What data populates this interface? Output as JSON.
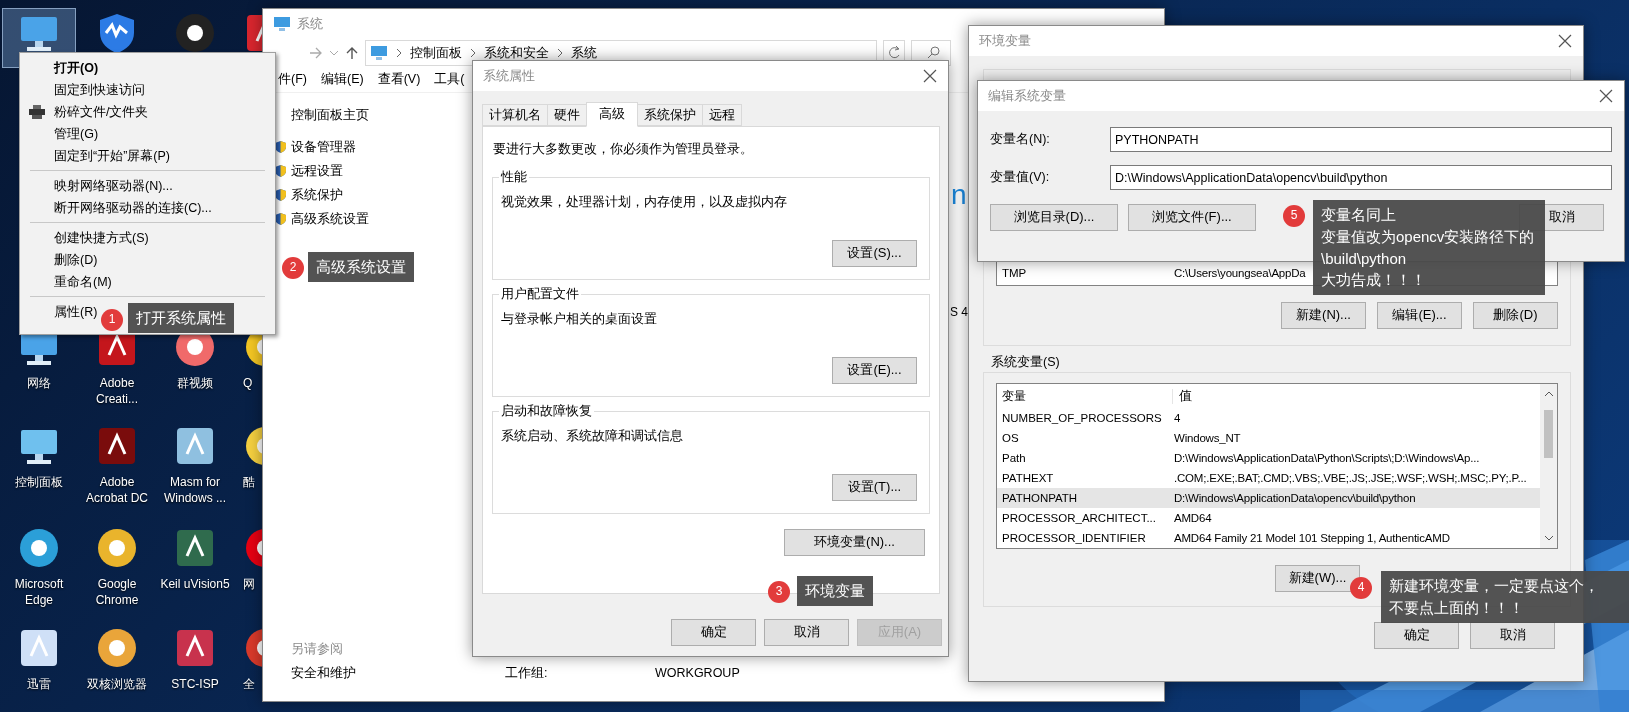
{
  "desktop": {
    "icon_rows": [
      [
        {
          "kind": "computer",
          "selected": true
        },
        {
          "kind": "guard",
          "selected": false
        },
        {
          "kind": "chat",
          "selected": false
        },
        {
          "kind": "red-app",
          "selected": false
        }
      ],
      [
        {
          "kind": "network",
          "label": "网络",
          "selected": false
        },
        {
          "kind": "creative",
          "label": "Adobe Creati...",
          "selected": false
        },
        {
          "kind": "video",
          "label": "群视频",
          "selected": false
        },
        {
          "kind": "qq",
          "label": "Q",
          "selected": false
        }
      ],
      [
        {
          "kind": "panel",
          "label": "控制面板",
          "selected": false
        },
        {
          "kind": "acrobat",
          "label": "Adobe Acrobat DC",
          "selected": false
        },
        {
          "kind": "asm",
          "label": "Masm for Windows ...",
          "selected": false
        },
        {
          "kind": "music",
          "label": "酷",
          "selected": false
        }
      ],
      [
        {
          "kind": "edge",
          "label": "Microsoft Edge",
          "selected": false
        },
        {
          "kind": "chrome",
          "label": "Google Chrome",
          "selected": false
        },
        {
          "kind": "keil",
          "label": "Keil uVision5",
          "selected": false
        },
        {
          "kind": "netease",
          "label": "网",
          "selected": false
        }
      ],
      [
        {
          "kind": "xunlei",
          "label": "迅雷",
          "selected": false
        },
        {
          "kind": "browser",
          "label": "双核浏览器",
          "selected": false
        },
        {
          "kind": "stc",
          "label": "STC-ISP",
          "selected": false
        },
        {
          "kind": "red",
          "label": "全",
          "selected": false
        }
      ]
    ]
  },
  "context_menu": {
    "items": [
      {
        "kind": "item",
        "label": "打开(O)",
        "default": true
      },
      {
        "kind": "item",
        "label": "固定到快速访问",
        "default": false
      },
      {
        "kind": "item-with-icon",
        "label": "粉碎文件/文件夹",
        "default": false
      },
      {
        "kind": "item",
        "label": "管理(G)",
        "default": false
      },
      {
        "kind": "item",
        "label": "固定到“开始”屏幕(P)",
        "default": false
      },
      {
        "kind": "separator"
      },
      {
        "kind": "item",
        "label": "映射网络驱动器(N)...",
        "default": false
      },
      {
        "kind": "item",
        "label": "断开网络驱动器的连接(C)...",
        "default": false
      },
      {
        "kind": "separator"
      },
      {
        "kind": "item",
        "label": "创建快捷方式(S)",
        "default": false
      },
      {
        "kind": "item",
        "label": "删除(D)",
        "default": false
      },
      {
        "kind": "item",
        "label": "重命名(M)",
        "default": false
      },
      {
        "kind": "separator"
      },
      {
        "kind": "item",
        "label": "属性(R)",
        "default": false
      }
    ]
  },
  "explorer": {
    "title": "系统",
    "breadcrumb": [
      "控制面板",
      "系统和安全",
      "系统"
    ],
    "menu": [
      "件(F)",
      "编辑(E)",
      "查看(V)",
      "工具("
    ],
    "home_link": "控制面板主页",
    "tasks": [
      "设备管理器",
      "远程设置",
      "系统保护",
      "高级系统设置"
    ],
    "see_also_heading": "另请参阅",
    "see_also": [
      "安全和维护"
    ],
    "logo_fragment": "n",
    "cut_text": "S 4",
    "workgroup_label": "工作组:",
    "workgroup_value": "WORKGROUP"
  },
  "system_properties": {
    "title": "系统属性",
    "tabs": [
      {
        "label": "计算机名",
        "selected": false
      },
      {
        "label": "硬件",
        "selected": false
      },
      {
        "label": "高级",
        "selected": true
      },
      {
        "label": "系统保护",
        "selected": false
      },
      {
        "label": "远程",
        "selected": false
      }
    ],
    "notice": "要进行大多数更改，你必须作为管理员登录。",
    "groups": [
      {
        "title": "性能",
        "description": "视觉效果，处理器计划，内存使用，以及虚拟内存",
        "button": "设置(S)..."
      },
      {
        "title": "用户配置文件",
        "description": "与登录帐户相关的桌面设置",
        "button": "设置(E)..."
      },
      {
        "title": "启动和故障恢复",
        "description": "系统启动、系统故障和调试信息",
        "button": "设置(T)..."
      }
    ],
    "env_button": "环境变量(N)...",
    "buttons": [
      {
        "label": "确定",
        "disabled": false
      },
      {
        "label": "取消",
        "disabled": false
      },
      {
        "label": "应用(A)",
        "disabled": true
      }
    ]
  },
  "environment_variables": {
    "title": "环境变量",
    "user_rows": [
      {
        "name": "TMP",
        "value": "C:\\Users\\youngsea\\AppDa"
      }
    ],
    "user_buttons": [
      "新建(N)...",
      "编辑(E)...",
      "删除(D)"
    ],
    "system_heading": "系统变量(S)",
    "columns": [
      "变量",
      "值"
    ],
    "system_rows": [
      {
        "name": "NUMBER_OF_PROCESSORS",
        "value": "4",
        "selected": false
      },
      {
        "name": "OS",
        "value": "Windows_NT",
        "selected": false
      },
      {
        "name": "Path",
        "value": "D:\\Windows\\ApplicationData\\Python\\Scripts\\;D:\\Windows\\Ap...",
        "selected": false
      },
      {
        "name": "PATHEXT",
        "value": ".COM;.EXE;.BAT;.CMD;.VBS;.VBE;.JS;.JSE;.WSF;.WSH;.MSC;.PY;.P...",
        "selected": false
      },
      {
        "name": "PATHONPATH",
        "value": "D:\\Windows\\ApplicationData\\opencv\\build\\python",
        "selected": true
      },
      {
        "name": "PROCESSOR_ARCHITECT...",
        "value": "AMD64",
        "selected": false
      },
      {
        "name": "PROCESSOR_IDENTIFIER",
        "value": "AMD64 Family 21 Model 101 Stepping 1, AuthenticAMD",
        "selected": false
      }
    ],
    "system_buttons": [
      "新建(W)..."
    ],
    "buttons": [
      "确定",
      "取消"
    ]
  },
  "edit_variable": {
    "title": "编辑系统变量",
    "fields": [
      {
        "label": "变量名(N):",
        "value": "PYTHONPATH"
      },
      {
        "label": "变量值(V):",
        "value": "D:\\Windows\\ApplicationData\\opencv\\build\\python"
      }
    ],
    "buttons": [
      "浏览目录(D)...",
      "浏览文件(F)..."
    ],
    "cancel": "取消"
  },
  "callouts": [
    {
      "number": "1",
      "lines": [
        "打开系统属性"
      ]
    },
    {
      "number": "2",
      "lines": [
        "高级系统设置"
      ]
    },
    {
      "number": "3",
      "lines": [
        "环境变量"
      ]
    },
    {
      "number": "4",
      "lines": [
        "新建环境变量，一定要点这个，",
        "不要点上面的！！！"
      ]
    },
    {
      "number": "5",
      "lines": [
        "变量名同上",
        "变量值改为opencv安装路径下的",
        "\\build\\python",
        "大功告成！！！"
      ]
    }
  ]
}
